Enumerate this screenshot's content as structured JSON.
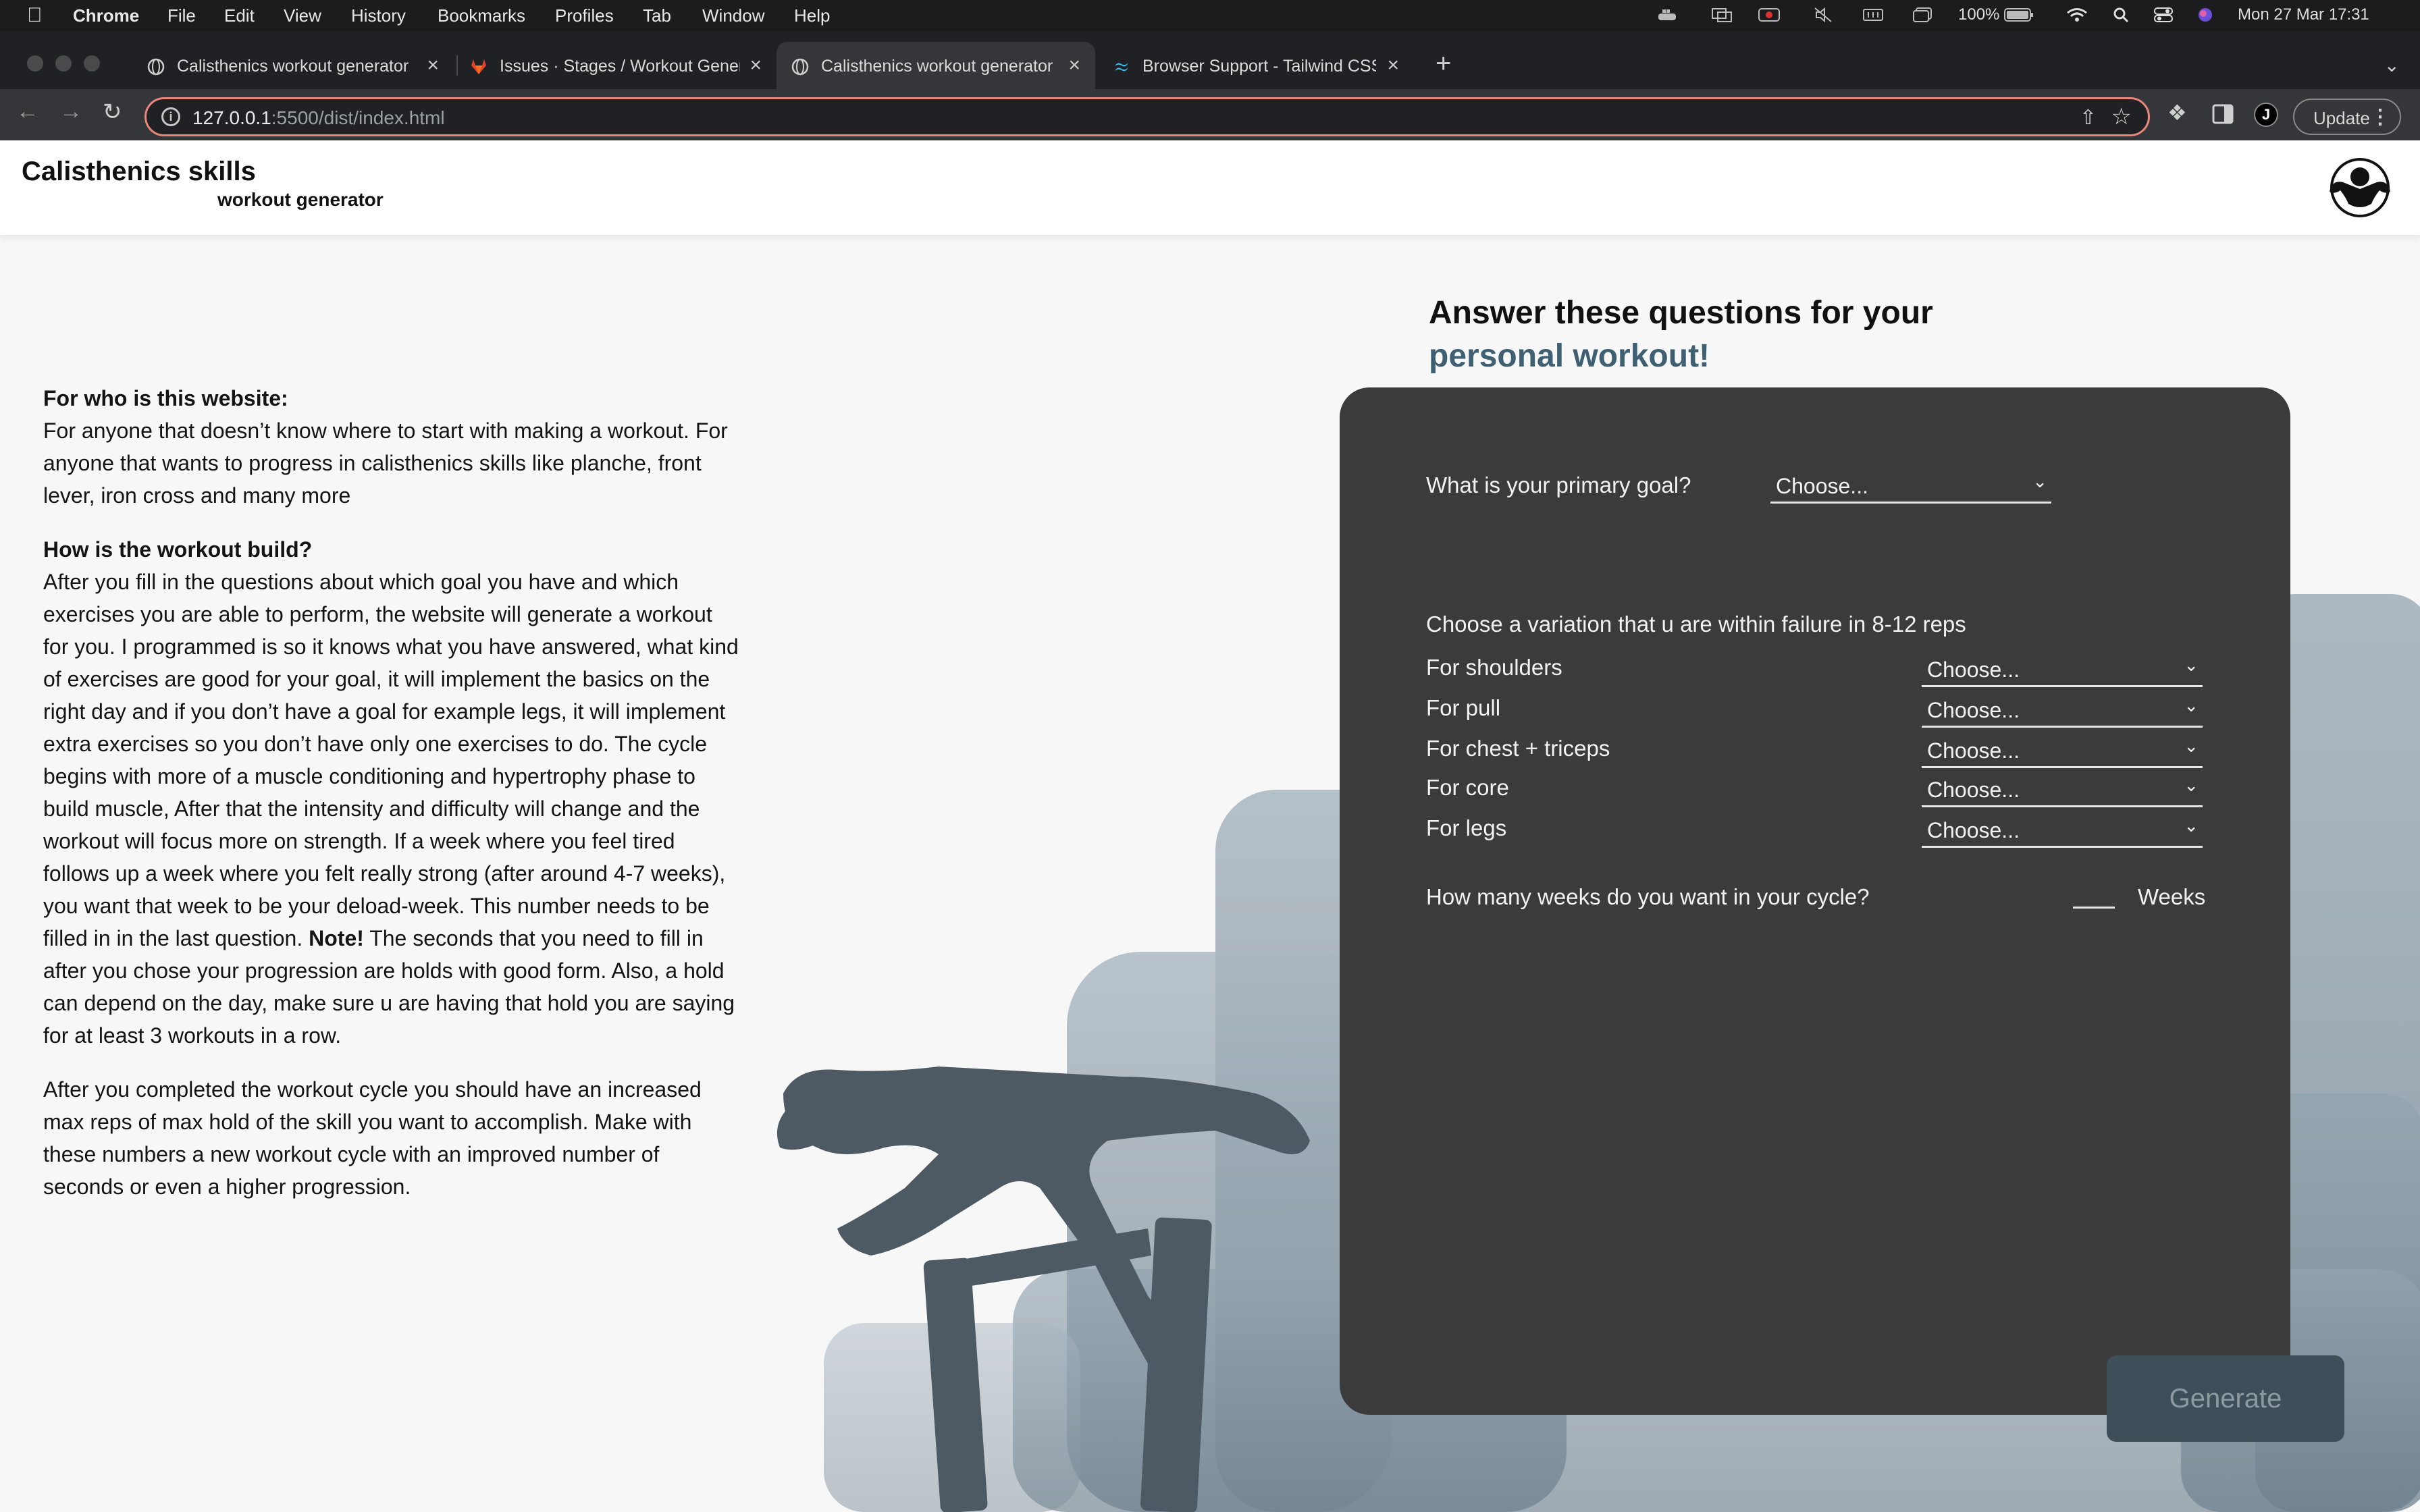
{
  "os_menubar": {
    "app": "Chrome",
    "items": [
      "File",
      "Edit",
      "View",
      "History",
      "Bookmarks",
      "Profiles",
      "Tab",
      "Window",
      "Help"
    ],
    "battery": "100%",
    "datetime": "Mon 27 Mar  17:31"
  },
  "browser": {
    "tabs": [
      {
        "title": "Calisthenics workout generator",
        "active": false
      },
      {
        "title": "Issues · Stages / Workout Generator",
        "active": false
      },
      {
        "title": "Calisthenics workout generator",
        "active": true
      },
      {
        "title": "Browser Support - Tailwind CSS",
        "active": false
      }
    ],
    "url_host": "127.0.0.1",
    "url_path": ":5500/dist/index.html",
    "profile_initial": "J",
    "update_label": "Update"
  },
  "header": {
    "title": "Calisthenics skills",
    "subtitle": "workout generator"
  },
  "info": {
    "who_heading": "For who is this website:",
    "who_body": "For anyone that doesn’t know where to start with making a workout. For anyone that wants to progress in calisthenics skills like planche, front lever, iron cross and many more",
    "how_heading": "How is the workout build?",
    "how_body_1": "After you fill in the questions about which goal you have and which exercises you are able to perform, the website will generate a workout for you. I programmed is so it knows what you have answered, what kind of exercises are good for your goal, it will implement the basics on the right day and if you don’t have a goal for example legs, it will implement extra exercises so you don’t have only one exercises to do. The cycle begins with more of a muscle conditioning and hypertrophy phase to build muscle, After that the intensity and difficulty will change and the workout will focus more on strength. If a week where you feel tired follows up a week where you felt really strong (after around 4-7 weeks), you want that week to be your deload-week. This number needs to be filled in in the last question.",
    "note_label": "Note!",
    "how_body_2": "The seconds that you need to fill in after you chose your progression are holds with good form. Also, a hold can depend on the day, make sure u are having that hold you are saying for at least 3 workouts in a row.",
    "after_body": "After you completed the workout cycle you should have an increased max reps of max hold of the skill you want to accomplish. Make with these numbers a new workout cycle with an improved number of seconds or even a higher progression."
  },
  "form": {
    "heading_line1": "Answer these questions for your",
    "heading_line2": "personal workout!",
    "goal_question": "What is your primary goal?",
    "goal_value": "Choose...",
    "variation_intro": "Choose a variation that u are within failure in 8-12 reps",
    "variations": [
      {
        "label": "For shoulders",
        "value": "Choose..."
      },
      {
        "label": "For pull",
        "value": "Choose..."
      },
      {
        "label": "For chest + triceps",
        "value": "Choose..."
      },
      {
        "label": "For core",
        "value": "Choose..."
      },
      {
        "label": "For legs",
        "value": "Choose..."
      }
    ],
    "weeks_question": "How many weeks do you want in your cycle?",
    "weeks_unit": "Weeks",
    "weeks_value": "",
    "generate_label": "Generate"
  },
  "colors": {
    "panel": "#3b3b3b",
    "accent": "#3f5f73",
    "generate_bg": "#3f4f5a"
  }
}
